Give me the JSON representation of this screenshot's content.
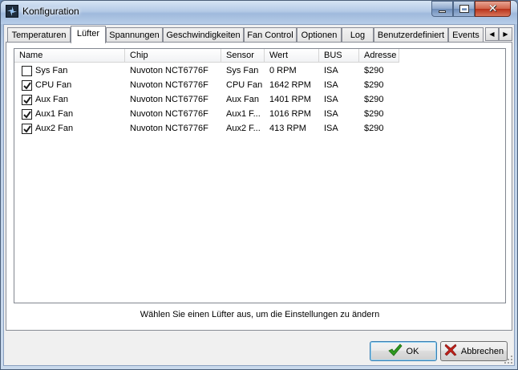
{
  "window": {
    "title": "Konfiguration"
  },
  "tabs": [
    {
      "label": "Temperaturen",
      "active": false
    },
    {
      "label": "Lüfter",
      "active": true
    },
    {
      "label": "Spannungen",
      "active": false
    },
    {
      "label": "Geschwindigkeiten",
      "active": false
    },
    {
      "label": "Fan Control",
      "active": false
    },
    {
      "label": "Optionen",
      "active": false
    },
    {
      "label": "Log",
      "active": false
    },
    {
      "label": "Benutzerdefiniert",
      "active": false
    },
    {
      "label": "Events",
      "active": false
    }
  ],
  "list": {
    "columns": [
      "Name",
      "Chip",
      "Sensor",
      "Wert",
      "BUS",
      "Adresse"
    ],
    "rows": [
      {
        "checked": false,
        "name": "Sys Fan",
        "chip": "Nuvoton NCT6776F",
        "sensor": "Sys Fan",
        "value": "0 RPM",
        "bus": "ISA",
        "address": "$290"
      },
      {
        "checked": true,
        "name": "CPU Fan",
        "chip": "Nuvoton NCT6776F",
        "sensor": "CPU Fan",
        "value": "1642 RPM",
        "bus": "ISA",
        "address": "$290"
      },
      {
        "checked": true,
        "name": "Aux Fan",
        "chip": "Nuvoton NCT6776F",
        "sensor": "Aux Fan",
        "value": "1401 RPM",
        "bus": "ISA",
        "address": "$290"
      },
      {
        "checked": true,
        "name": "Aux1 Fan",
        "chip": "Nuvoton NCT6776F",
        "sensor": "Aux1 F...",
        "value": "1016 RPM",
        "bus": "ISA",
        "address": "$290"
      },
      {
        "checked": true,
        "name": "Aux2 Fan",
        "chip": "Nuvoton NCT6776F",
        "sensor": "Aux2 F...",
        "value": "413 RPM",
        "bus": "ISA",
        "address": "$290"
      }
    ]
  },
  "hint": "Wählen Sie einen Lüfter aus, um die Einstellungen zu ändern",
  "buttons": {
    "ok": "OK",
    "cancel": "Abbrechen"
  },
  "colors": {
    "ok_icon": "#2e9a1f",
    "cancel_icon": "#c0201a"
  }
}
